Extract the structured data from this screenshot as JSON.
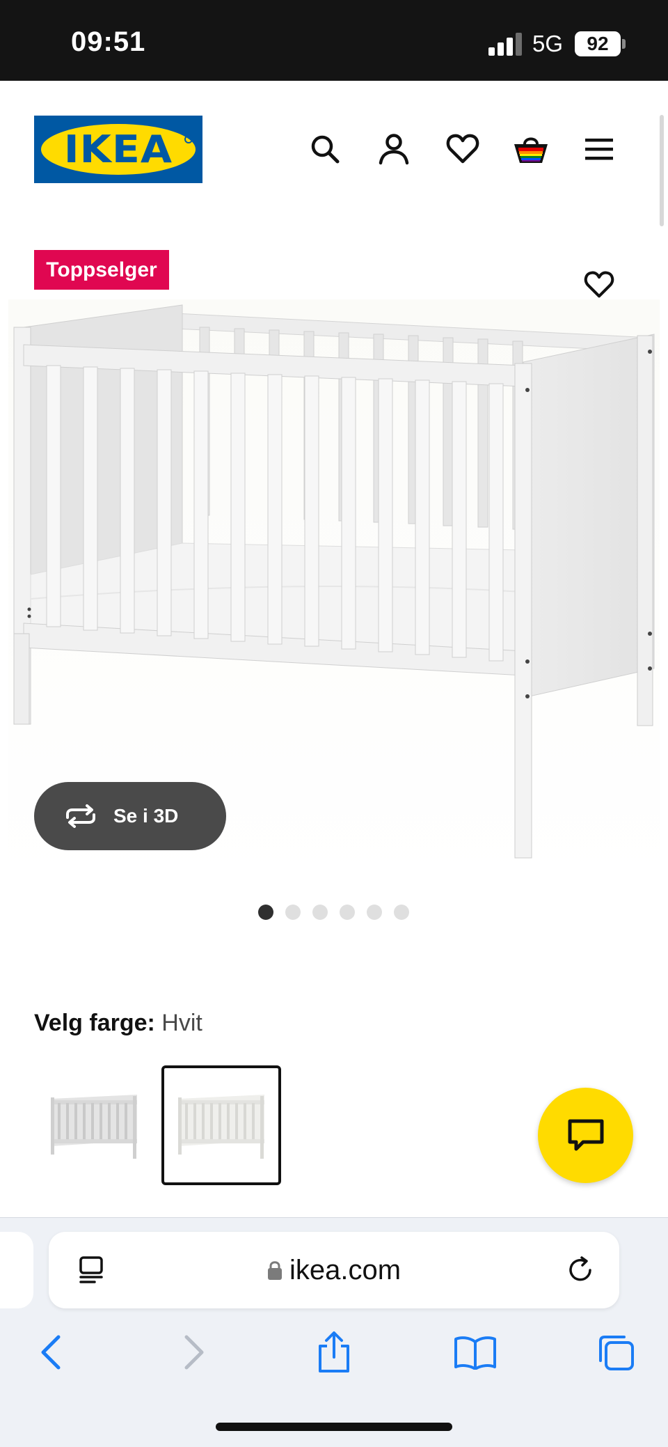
{
  "status_bar": {
    "time": "09:51",
    "network": "5G",
    "battery": "92"
  },
  "header": {
    "logo_text": "IKEA",
    "icons": [
      "search-icon",
      "account-icon",
      "favourites-icon",
      "shopping-bag-icon",
      "menu-icon"
    ]
  },
  "product": {
    "badge": "Toppselger",
    "view_3d_label": "Se i 3D",
    "carousel": {
      "total": 6,
      "active": 1
    },
    "color": {
      "label": "Velg farge:",
      "value": "Hvit",
      "swatch_count": 2,
      "selected_index": 2
    }
  },
  "browser": {
    "url": "ikea.com",
    "toolbar": [
      "back-icon",
      "forward-icon",
      "share-icon",
      "bookmarks-icon",
      "tabs-icon"
    ]
  },
  "colors": {
    "ikea_blue": "#0058a3",
    "ikea_yellow": "#ffdb00",
    "badge_red": "#e00751",
    "ios_blue": "#1a7cf5"
  }
}
